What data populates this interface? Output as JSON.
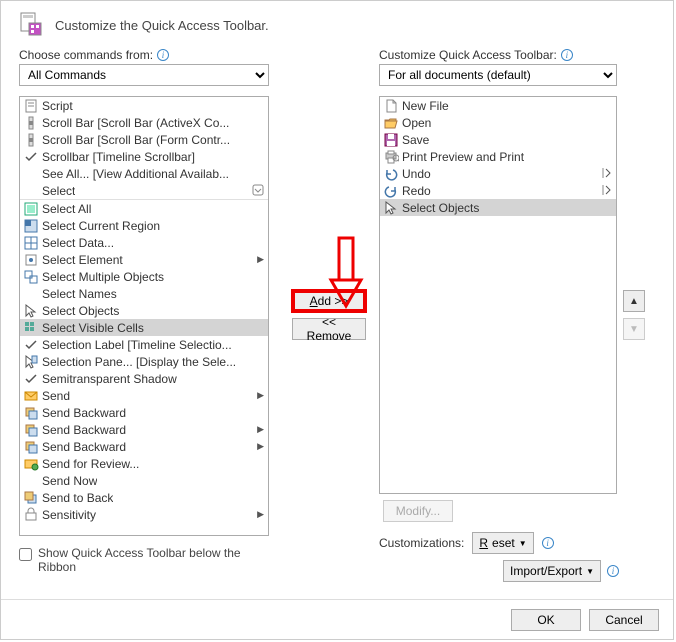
{
  "title": "Customize the Quick Access Toolbar.",
  "left": {
    "label": "Choose commands from:",
    "combo": "All Commands",
    "items": [
      {
        "icon": "script",
        "text": "Script"
      },
      {
        "icon": "scroll",
        "text": "Scroll Bar [Scroll Bar (ActiveX Co..."
      },
      {
        "icon": "scroll",
        "text": "Scroll Bar [Scroll Bar (Form Contr..."
      },
      {
        "icon": "check",
        "text": "Scrollbar [Timeline Scrollbar]"
      },
      {
        "icon": "",
        "text": "See All... [View Additional Availab..."
      },
      {
        "icon": "",
        "text": "Select",
        "submenu": "box"
      },
      {
        "icon": "selall",
        "text": "Select All"
      },
      {
        "icon": "region",
        "text": "Select Current Region"
      },
      {
        "icon": "grid",
        "text": "Select Data..."
      },
      {
        "icon": "sele",
        "text": "Select Element",
        "submenu": "tri"
      },
      {
        "icon": "multi",
        "text": "Select Multiple Objects"
      },
      {
        "icon": "",
        "text": "Select Names"
      },
      {
        "icon": "cursor",
        "text": "Select Objects"
      },
      {
        "icon": "vis",
        "text": "Select Visible Cells",
        "selected": true
      },
      {
        "icon": "check",
        "text": "Selection Label [Timeline Selectio..."
      },
      {
        "icon": "pane",
        "text": "Selection Pane... [Display the Sele..."
      },
      {
        "icon": "check",
        "text": "Semitransparent Shadow"
      },
      {
        "icon": "send",
        "text": "Send",
        "submenu": "tri"
      },
      {
        "icon": "sb",
        "text": "Send Backward"
      },
      {
        "icon": "sb",
        "text": "Send Backward",
        "submenu": "tri"
      },
      {
        "icon": "sb",
        "text": "Send Backward",
        "submenu": "tri"
      },
      {
        "icon": "review",
        "text": "Send for Review..."
      },
      {
        "icon": "",
        "text": "Send Now"
      },
      {
        "icon": "stb",
        "text": "Send to Back"
      },
      {
        "icon": "sens",
        "text": "Sensitivity",
        "submenu": "tri"
      }
    ],
    "checkbox": "Show Quick Access Toolbar below the Ribbon"
  },
  "mid": {
    "add": "Add >>",
    "remove": "<< Remove"
  },
  "right": {
    "label": "Customize Quick Access Toolbar:",
    "combo": "For all documents (default)",
    "items": [
      {
        "icon": "newfile",
        "text": "New File"
      },
      {
        "icon": "open",
        "text": "Open"
      },
      {
        "icon": "save",
        "text": "Save"
      },
      {
        "icon": "print",
        "text": "Print Preview and Print"
      },
      {
        "icon": "undo",
        "text": "Undo",
        "submenu": "split"
      },
      {
        "icon": "redo",
        "text": "Redo",
        "submenu": "split"
      },
      {
        "icon": "cursor",
        "text": "Select Objects",
        "selected": true
      }
    ],
    "modify": "Modify...",
    "custom_label": "Customizations:",
    "reset": "Reset",
    "import_export": "Import/Export"
  },
  "footer": {
    "ok": "OK",
    "cancel": "Cancel"
  }
}
